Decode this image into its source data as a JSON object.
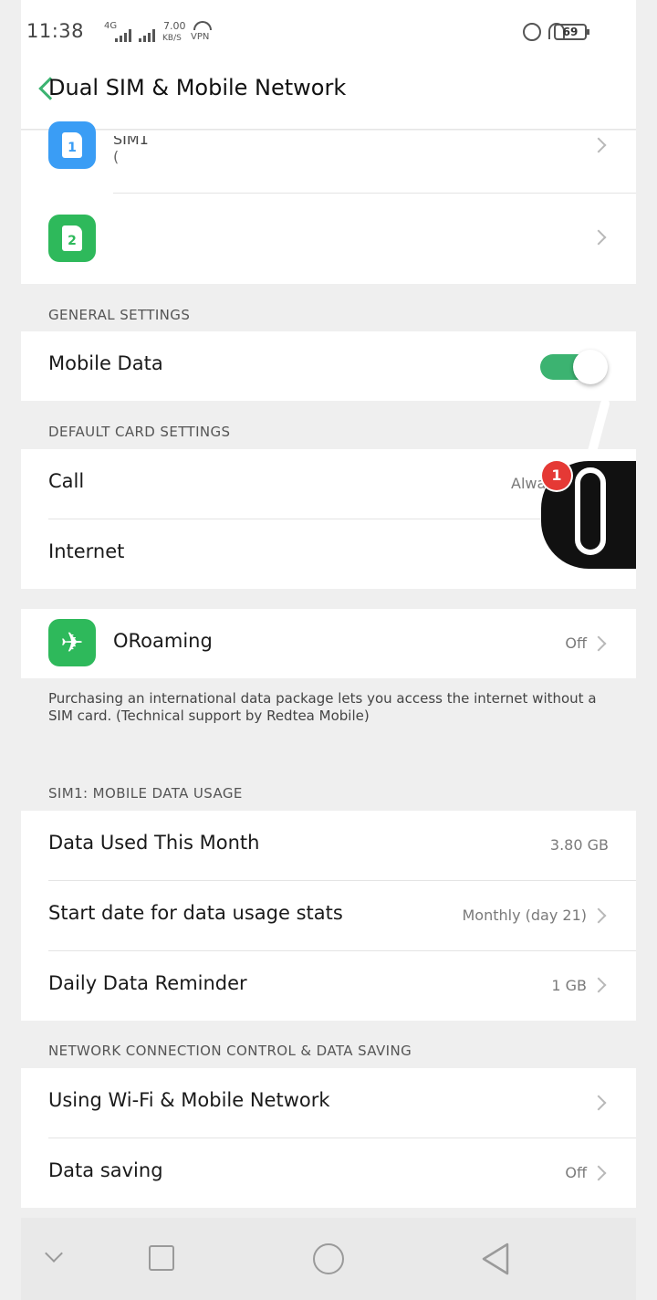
{
  "status_bar": {
    "time": "11:38",
    "network_type": "4G",
    "speed_value": "7.00",
    "speed_unit": "KB/S",
    "vpn": "VPN",
    "battery": "69"
  },
  "header": {
    "title": "Dual SIM & Mobile Network"
  },
  "sim_cards": [
    {
      "icon_text": "1",
      "name": "SIM1",
      "subtitle": "(",
      "color": "#3a9df5"
    },
    {
      "icon_text": "2",
      "name": "",
      "subtitle": "",
      "color": "#2eb95b"
    }
  ],
  "general_settings": {
    "section_label": "GENERAL SETTINGS",
    "mobile_data_label": "Mobile Data",
    "mobile_data_on": true
  },
  "default_card_settings": {
    "section_label": "DEFAULT CARD SETTINGS",
    "call_label": "Call",
    "call_value": "Alwa",
    "internet_label": "Internet"
  },
  "oroaming": {
    "label": "ORoaming",
    "value": "Off",
    "note": "Purchasing an international data package lets you access the internet without a SIM card. (Technical support by Redtea Mobile)"
  },
  "data_usage": {
    "section_label": "SIM1: MOBILE DATA USAGE",
    "rows": [
      {
        "label": "Data Used This Month",
        "value": "3.80 GB"
      },
      {
        "label": "Start date for data usage stats",
        "value": "Monthly (day 21)"
      },
      {
        "label": "Daily Data Reminder",
        "value": "1 GB"
      }
    ]
  },
  "network_control": {
    "section_label": "NETWORK CONNECTION CONTROL & DATA SAVING",
    "rows": [
      {
        "label": "Using Wi-Fi & Mobile Network",
        "value": ""
      },
      {
        "label": "Data saving",
        "value": "Off"
      }
    ]
  },
  "floating_bubble": {
    "badge_count": "1"
  },
  "icons": {
    "back": "chevron-left-icon",
    "chevron": "chevron-right-icon",
    "roaming": "airplane-icon",
    "nav_back": "triangle-back-icon",
    "nav_home": "circle-home-icon",
    "nav_recent": "square-recent-icon",
    "nav_hide": "chevron-down-icon"
  },
  "colors": {
    "accent_green": "#3cb371",
    "sim1_blue": "#3a9df5",
    "badge_red": "#e53935"
  }
}
